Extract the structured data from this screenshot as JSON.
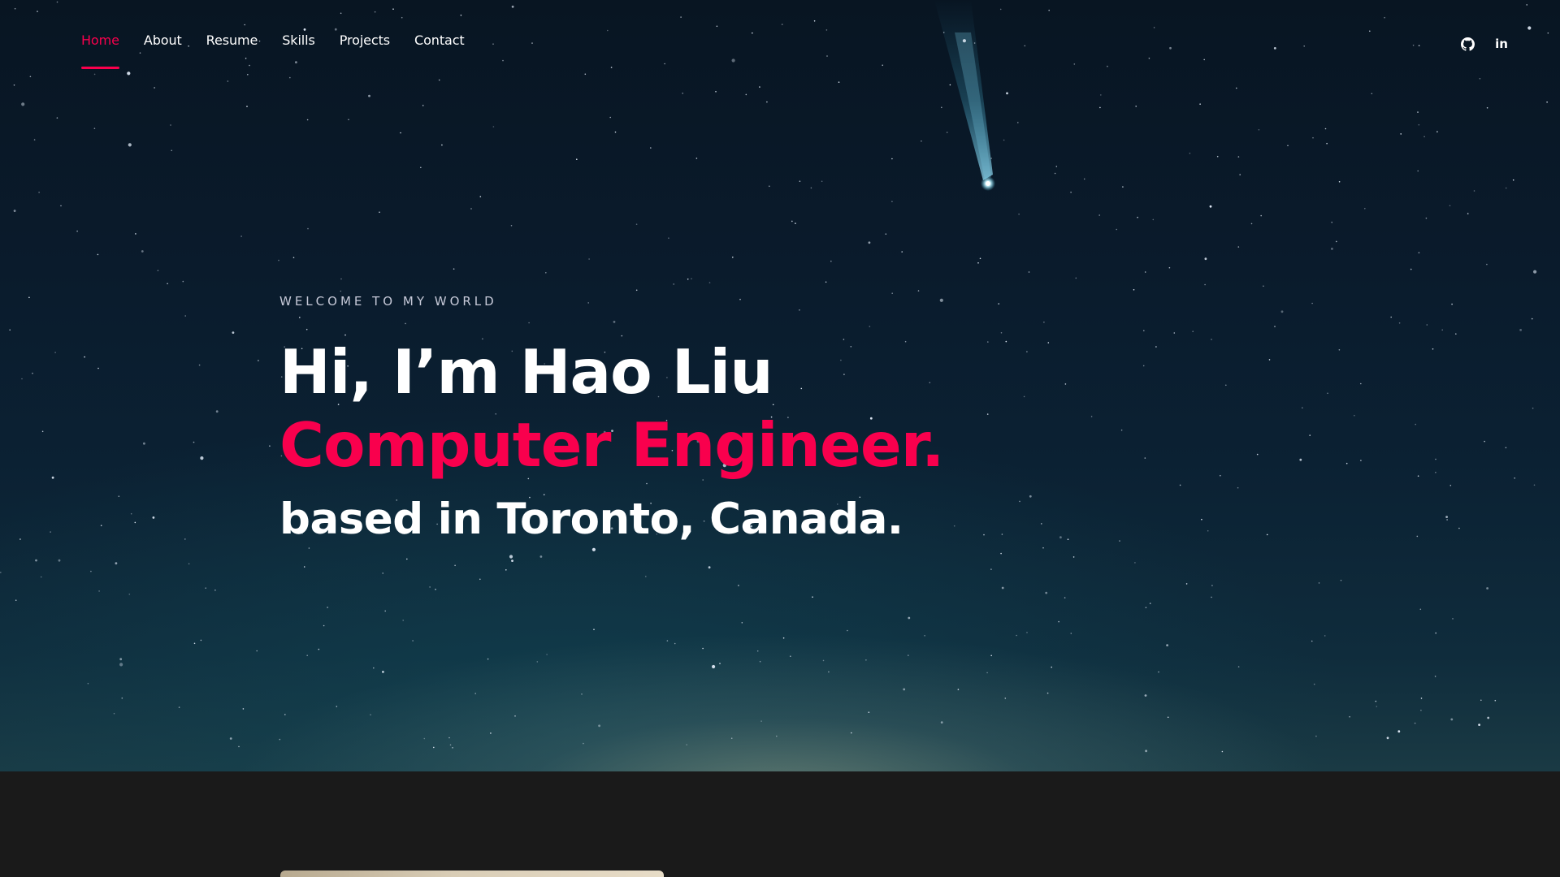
{
  "nav": {
    "items": [
      {
        "label": "Home",
        "active": true
      },
      {
        "label": "About",
        "active": false
      },
      {
        "label": "Resume",
        "active": false
      },
      {
        "label": "Skills",
        "active": false
      },
      {
        "label": "Projects",
        "active": false
      },
      {
        "label": "Contact",
        "active": false
      }
    ],
    "active_color": "#f9004d"
  },
  "social": {
    "icons": [
      "github-icon",
      "linkedin-icon"
    ],
    "linkedin_glyph": "in"
  },
  "hero": {
    "eyebrow": "WELCOME TO MY WORLD",
    "title": "Hi, I’m Hao Liu",
    "accent_line": "Computer Engineer.",
    "subtitle": "based in Toronto, Canada.",
    "accent_color": "#f9004d"
  }
}
